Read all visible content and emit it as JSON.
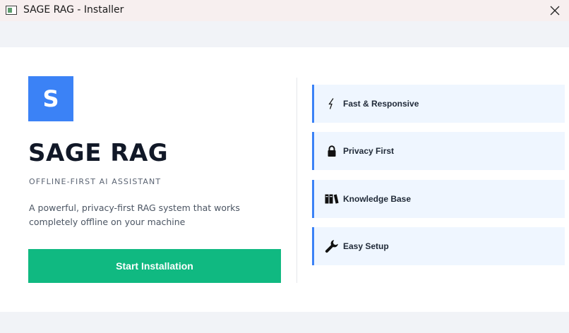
{
  "window": {
    "title": "SAGE RAG - Installer"
  },
  "hero": {
    "logo_letter": "S",
    "app_name": "SAGE RAG",
    "tagline": "OFFLINE-FIRST AI ASSISTANT",
    "description": "A powerful, privacy-first RAG system that works completely offline on your machine",
    "install_button_label": "Start Installation"
  },
  "features": [
    {
      "label": "Fast & Responsive",
      "icon": "lightning-icon"
    },
    {
      "label": "Privacy First",
      "icon": "lock-icon"
    },
    {
      "label": "Knowledge Base",
      "icon": "books-icon"
    },
    {
      "label": "Easy Setup",
      "icon": "wrench-icon"
    }
  ],
  "colors": {
    "accent": "#3b82f6",
    "install_button": "#10b981",
    "feature_card_bg": "#eff6ff",
    "titlebar_bg": "#f7efef",
    "band_bg": "#f1f3f7"
  }
}
